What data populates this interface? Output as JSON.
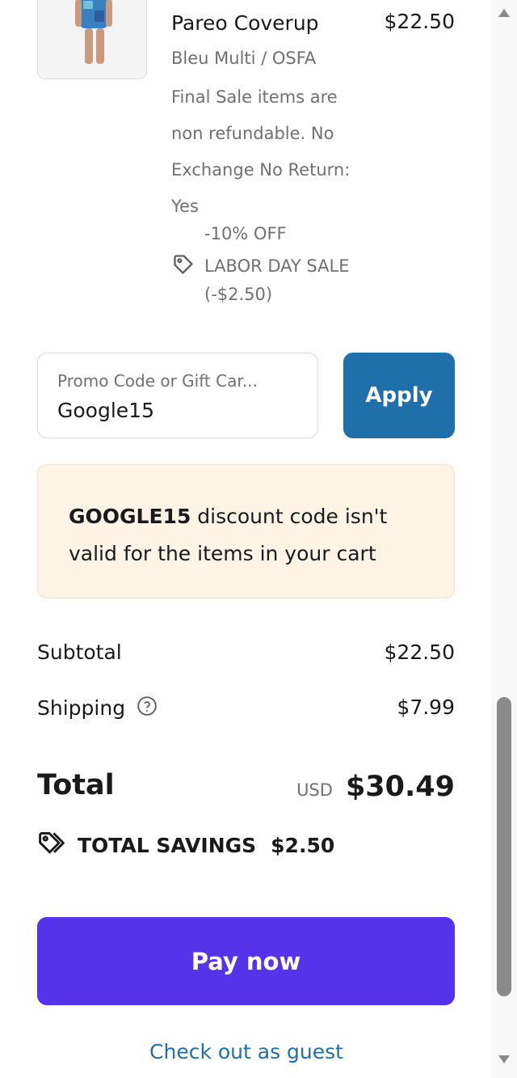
{
  "item": {
    "title": "Pareo Coverup",
    "price": "$22.50",
    "variant": "Bleu Multi / OSFA",
    "note": "Final Sale items are non refundable. No Exchange No Return: Yes",
    "discount_percent": "-10% OFF",
    "discount_name": "LABOR DAY SALE",
    "discount_amount": "(-$2.50)",
    "thumbnail_icon": "product-image"
  },
  "promo": {
    "placeholder": "Promo Code or Gift Car...",
    "value": "Google15",
    "apply_label": "Apply"
  },
  "error": {
    "code": "GOOGLE15",
    "message": " discount code isn't valid for the items in your cart"
  },
  "summary": {
    "subtotal_label": "Subtotal",
    "subtotal_value": "$22.50",
    "shipping_label": "Shipping",
    "shipping_value": "$7.99",
    "total_label": "Total",
    "currency": "USD",
    "total_value": "$30.49",
    "savings_label": "TOTAL SAVINGS",
    "savings_value": "$2.50"
  },
  "actions": {
    "pay_label": "Pay now",
    "guest_label": "Check out as guest"
  },
  "colors": {
    "apply_button": "#1f6fab",
    "pay_button": "#5433eb",
    "notice_bg": "#fff4e6",
    "link": "#1f6fab"
  }
}
